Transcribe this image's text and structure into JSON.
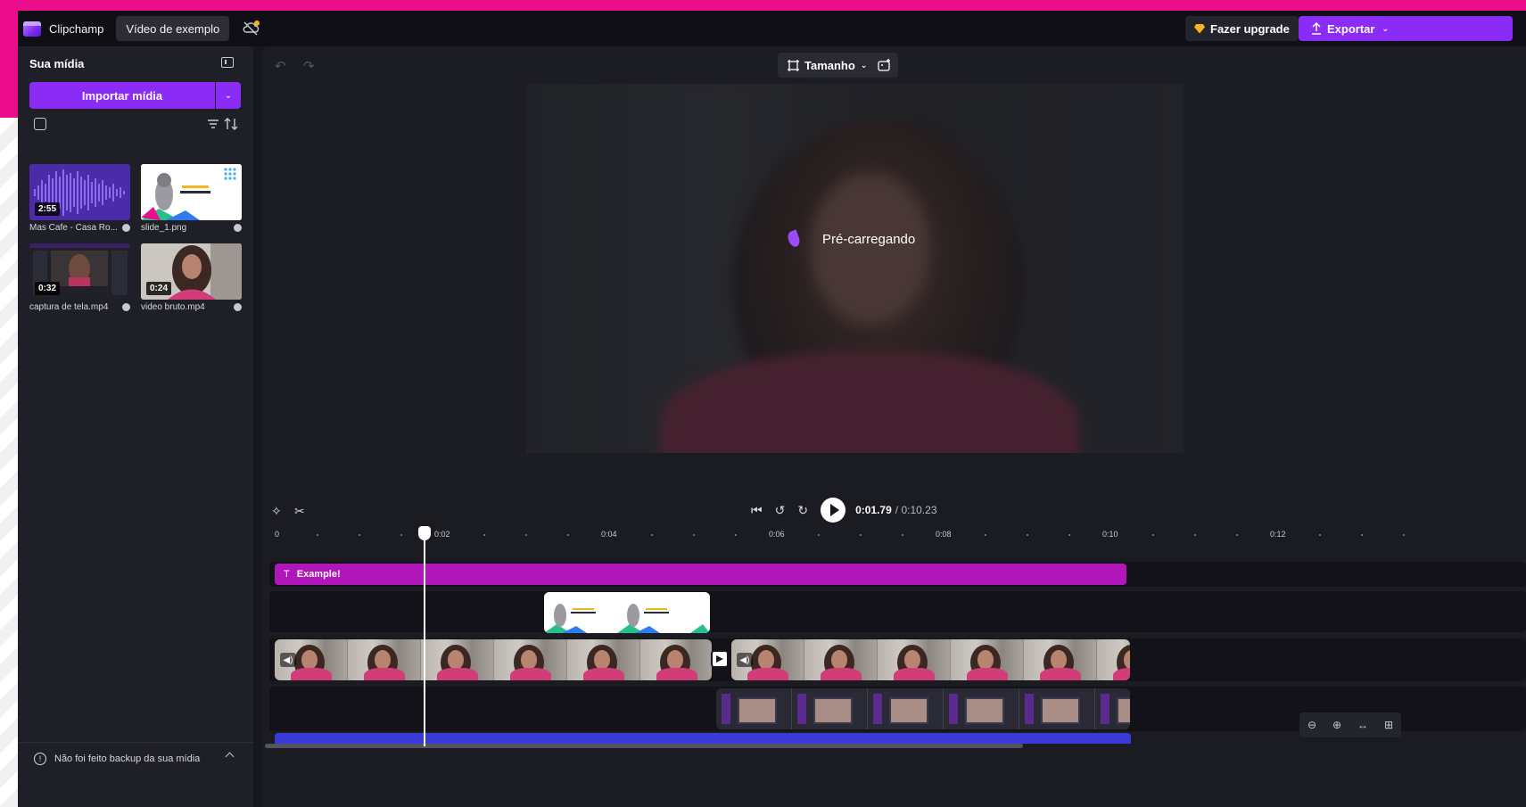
{
  "app": {
    "name": "Clipchamp",
    "project_title": "Vídeo de exemplo",
    "upgrade_label": "Fazer upgrade",
    "export_label": "Exportar",
    "accent_color": "#8a2cf6",
    "brand_pink": "#ec0d8c"
  },
  "media_panel": {
    "title": "Sua mídia",
    "import_label": "Importar mídia",
    "items": [
      {
        "name": "Mas Cafe - Casa Ro...",
        "duration": "2:55",
        "type": "audio"
      },
      {
        "name": "slide_1.png",
        "duration": "",
        "type": "image"
      },
      {
        "name": "captura de tela.mp4",
        "duration": "0:32",
        "type": "video"
      },
      {
        "name": "video bruto.mp4",
        "duration": "0:24",
        "type": "video"
      }
    ],
    "backup_notice": "Não foi feito backup da sua mídia"
  },
  "preview": {
    "size_label": "Tamanho",
    "loading_text": "Pré-carregando"
  },
  "playback": {
    "current_time": "0:01.79",
    "total_time": "/ 0:10.23"
  },
  "timeline": {
    "ruler_labels": [
      "0",
      "0:02",
      "0:04",
      "0:06",
      "0:08",
      "0:10",
      "0:12"
    ],
    "text_clip_label": "Example!",
    "playhead_seconds": 1.79
  },
  "icons": {
    "logo": "clipchamp-logo",
    "sync": "cloud-off-icon",
    "undo": "undo-icon",
    "redo": "redo-icon",
    "cut": "scissors-icon",
    "magic": "magic-wand-icon",
    "skip_back": "skip-back-icon",
    "rewind": "rewind-5-icon",
    "forward": "forward-5-icon",
    "zoom_out": "zoom-out-icon",
    "zoom_in": "zoom-in-icon",
    "fit": "fit-icon"
  }
}
